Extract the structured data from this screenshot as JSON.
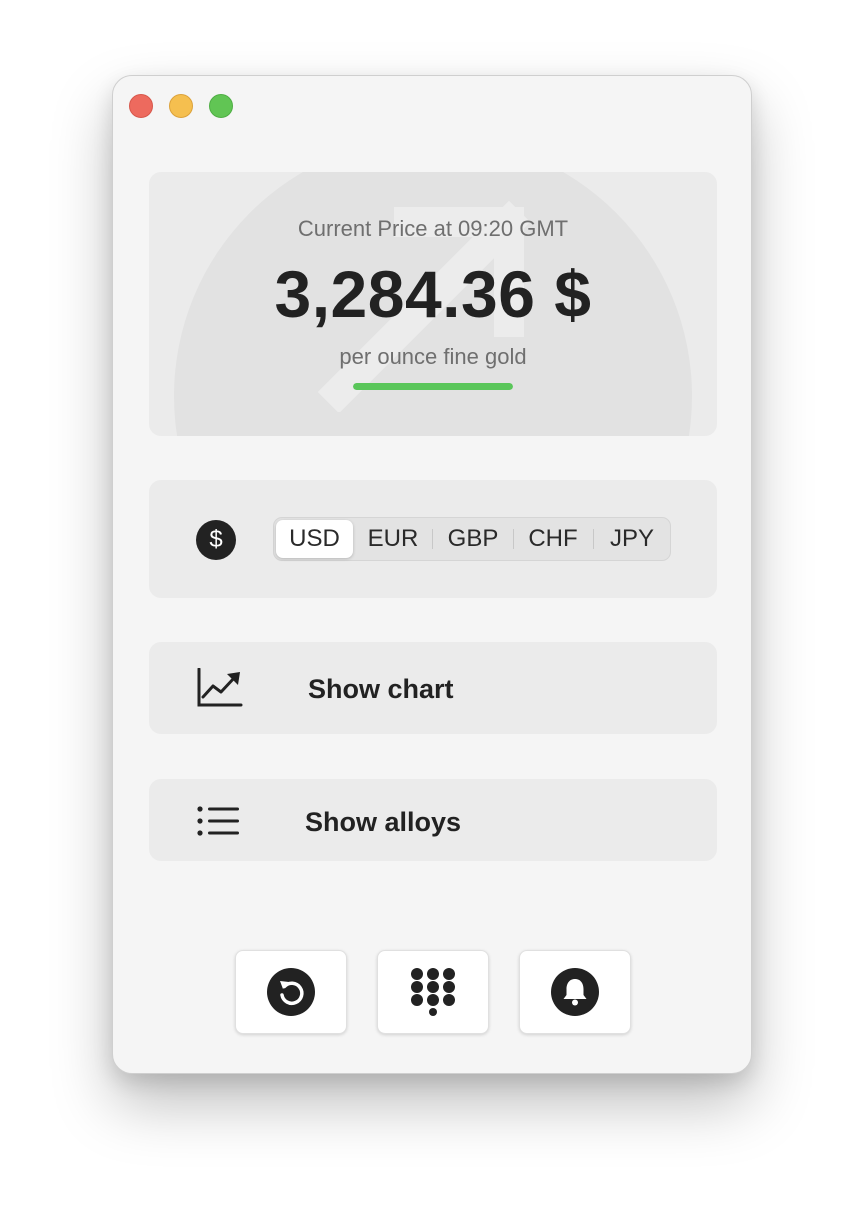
{
  "price": {
    "caption": "Current Price at 09:20 GMT",
    "value": "3,284.36 $",
    "unit": "per ounce fine gold",
    "progress": 1.0
  },
  "currency": {
    "icon_symbol": "$",
    "options": [
      "USD",
      "EUR",
      "GBP",
      "CHF",
      "JPY"
    ],
    "selected": "USD"
  },
  "actions": {
    "chart_label": "Show chart",
    "alloys_label": "Show alloys"
  },
  "toolbar": {
    "icons": [
      "refresh-icon",
      "keypad-icon",
      "bell-icon"
    ]
  },
  "colors": {
    "accent_green": "#5ac65a",
    "traffic_close": "#ed6a5e",
    "traffic_minimize": "#f5bf4f",
    "traffic_maximize": "#61c554"
  }
}
